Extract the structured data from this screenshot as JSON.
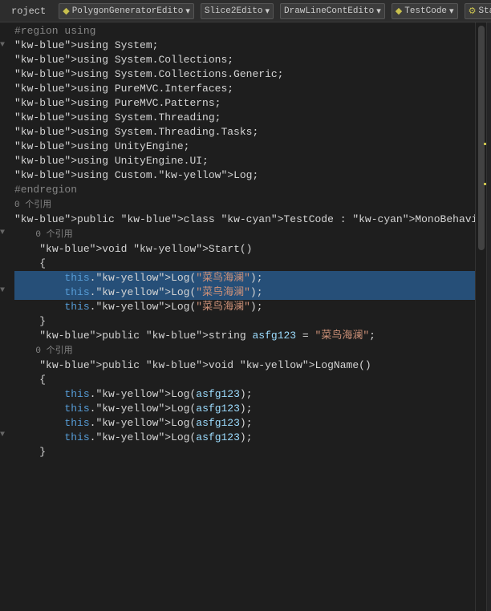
{
  "topbar": {
    "item1": "roject",
    "separator1": "_",
    "dropdown1_icon": "◆",
    "dropdown1_label": "PolygonGeneratorEdito",
    "dropdown2_label": "Slice2Edito",
    "dropdown3_label": "DrawLineContEdito",
    "dropdown4_icon": "◆",
    "dropdown4_label": "TestCode",
    "dropdown5_icon": "⚙",
    "dropdown5_label": "Start()",
    "expand_icon": "⊕"
  },
  "lines": [
    {
      "num": "",
      "fold": "",
      "content": "#region using",
      "classes": "kw-region"
    },
    {
      "num": "",
      "fold": "▼",
      "content": "using System;",
      "classes": ""
    },
    {
      "num": "",
      "fold": "",
      "content": "using System.Collections;",
      "classes": ""
    },
    {
      "num": "",
      "fold": "",
      "content": "using System.Collections.Generic;",
      "classes": ""
    },
    {
      "num": "",
      "fold": "",
      "content": "using PureMVC.Interfaces;",
      "classes": ""
    },
    {
      "num": "",
      "fold": "",
      "content": "using PureMVC.Patterns;",
      "classes": ""
    },
    {
      "num": "",
      "fold": "",
      "content": "using System.Threading;",
      "classes": ""
    },
    {
      "num": "",
      "fold": "",
      "content": "using System.Threading.Tasks;",
      "classes": ""
    },
    {
      "num": "",
      "fold": "",
      "content": "using UnityEngine;",
      "classes": ""
    },
    {
      "num": "",
      "fold": "",
      "content": "using UnityEngine.UI;",
      "classes": ""
    },
    {
      "num": "",
      "fold": "",
      "content": "using Custom.Log;",
      "classes": ""
    },
    {
      "num": "",
      "fold": "",
      "content": "#endregion",
      "classes": "kw-region"
    },
    {
      "num": "",
      "fold": "",
      "content": "",
      "classes": ""
    },
    {
      "num": "",
      "fold": "",
      "content": "0 个引用",
      "classes": "ref-count"
    },
    {
      "num": "",
      "fold": "▼",
      "content": "public class TestCode : MonoBehaviour {",
      "classes": ""
    },
    {
      "num": "",
      "fold": "",
      "content": "",
      "classes": ""
    },
    {
      "num": "",
      "fold": "",
      "content": "",
      "classes": ""
    },
    {
      "num": "",
      "fold": "",
      "content": "    0 个引用",
      "classes": "ref-count"
    },
    {
      "num": "",
      "fold": "▼",
      "content": "    void Start()",
      "classes": ""
    },
    {
      "num": "",
      "fold": "",
      "content": "    {",
      "classes": ""
    },
    {
      "num": "",
      "fold": "",
      "content": "        this.Log(\"菜鸟海澜\");",
      "classes": "highlighted"
    },
    {
      "num": "",
      "fold": "",
      "content": "        this.Log(\"菜鸟海澜\");",
      "classes": "highlighted"
    },
    {
      "num": "",
      "fold": "",
      "content": "        this.Log(\"菜鸟海澜\");",
      "classes": ""
    },
    {
      "num": "",
      "fold": "",
      "content": "",
      "classes": ""
    },
    {
      "num": "",
      "fold": "",
      "content": "    }",
      "classes": ""
    },
    {
      "num": "",
      "fold": "",
      "content": "",
      "classes": ""
    },
    {
      "num": "",
      "fold": "",
      "content": "    public string asfg123 = \"菜鸟海澜\";",
      "classes": ""
    },
    {
      "num": "",
      "fold": "",
      "content": "    0 个引用",
      "classes": "ref-count"
    },
    {
      "num": "",
      "fold": "▼",
      "content": "    public void LogName()",
      "classes": ""
    },
    {
      "num": "",
      "fold": "",
      "content": "    {",
      "classes": ""
    },
    {
      "num": "",
      "fold": "",
      "content": "        this.Log(asfg123);",
      "classes": ""
    },
    {
      "num": "",
      "fold": "",
      "content": "        this.Log(asfg123);",
      "classes": ""
    },
    {
      "num": "",
      "fold": "",
      "content": "        this.Log(asfg123);",
      "classes": ""
    },
    {
      "num": "",
      "fold": "",
      "content": "        this.Log(asfg123);",
      "classes": ""
    },
    {
      "num": "",
      "fold": "",
      "content": "    }",
      "classes": ""
    }
  ],
  "colors": {
    "bg": "#1e1e1e",
    "highlight": "#264f78",
    "linenum": "#858585"
  }
}
